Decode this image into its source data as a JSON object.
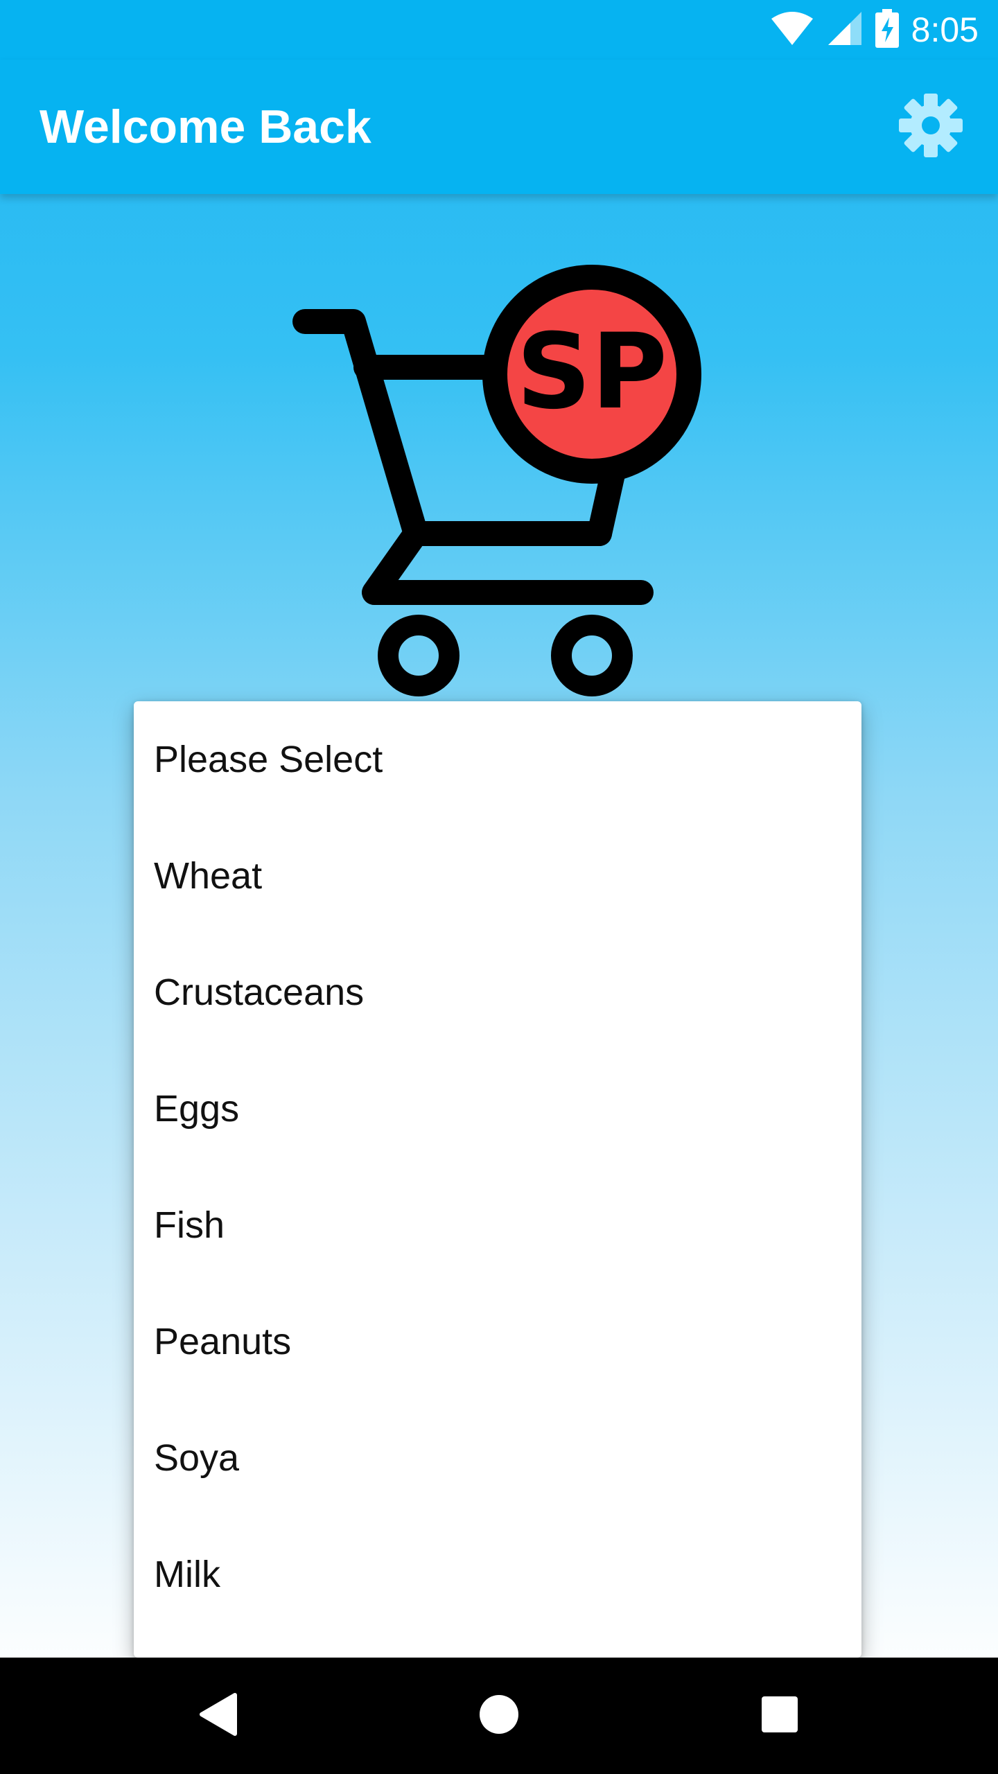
{
  "status_bar": {
    "time": "8:05",
    "icons": [
      "wifi-icon",
      "signal-icon",
      "battery-charging-icon"
    ]
  },
  "app_bar": {
    "title": "Welcome Back",
    "settings_icon": "gear-icon"
  },
  "logo": {
    "text": "SP",
    "icon": "shopping-cart-icon",
    "badge_color": "#f44545"
  },
  "dropdown": {
    "options": [
      "Please Select",
      "Wheat",
      "Crustaceans",
      "Eggs",
      "Fish",
      "Peanuts",
      "Soya",
      "Milk"
    ]
  },
  "nav_bar": {
    "back_icon": "back-triangle-icon",
    "home_icon": "home-circle-icon",
    "recents_icon": "recents-square-icon"
  },
  "colors": {
    "primary": "#06b3f1",
    "accent_red": "#f44545",
    "background_top": "#1fb6f2",
    "background_bottom": "#ffffff"
  }
}
